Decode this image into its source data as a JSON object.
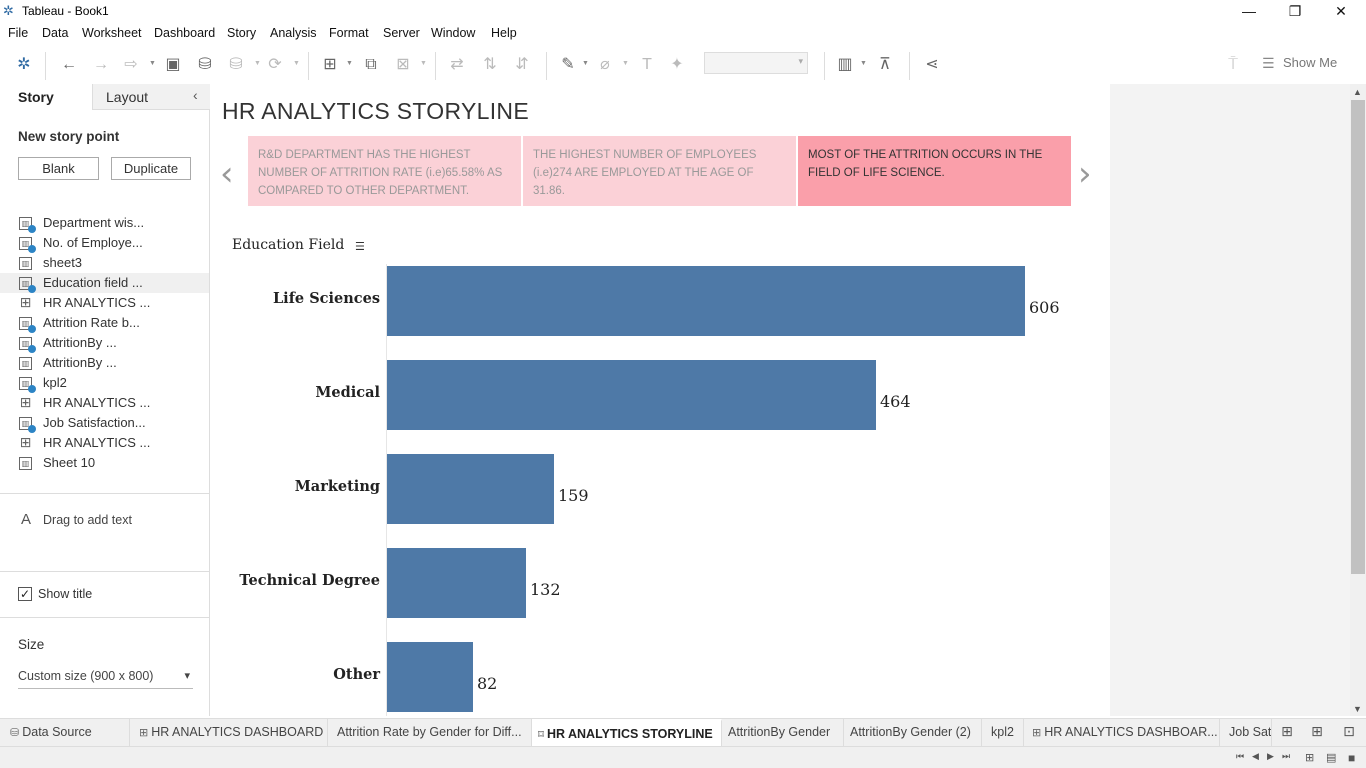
{
  "window": {
    "title": "Tableau - Book1",
    "controls": [
      "minimize",
      "restore",
      "close"
    ]
  },
  "menu": [
    "File",
    "Data",
    "Worksheet",
    "Dashboard",
    "Story",
    "Analysis",
    "Format",
    "Server",
    "Window",
    "Help"
  ],
  "toolbar": {
    "show_me": "Show Me"
  },
  "sidebar": {
    "tabs": {
      "story": "Story",
      "layout": "Layout"
    },
    "new_story_point": "New story point",
    "blank_button": "Blank",
    "duplicate_button": "Duplicate",
    "sheets": [
      {
        "label": "Department wis...",
        "type": "sheet",
        "used": true
      },
      {
        "label": "No. of Employe...",
        "type": "sheet",
        "used": true
      },
      {
        "label": "sheet3",
        "type": "sheet",
        "used": false
      },
      {
        "label": "Education field ...",
        "type": "sheet",
        "used": true
      },
      {
        "label": "HR ANALYTICS ...",
        "type": "dashboard",
        "used": false
      },
      {
        "label": "Attrition Rate b...",
        "type": "sheet",
        "used": true
      },
      {
        "label": "AttritionBy ...",
        "type": "sheet",
        "used": true
      },
      {
        "label": "AttritionBy ...",
        "type": "sheet",
        "used": false
      },
      {
        "label": "kpl2",
        "type": "sheet",
        "used": true
      },
      {
        "label": "HR ANALYTICS ...",
        "type": "dashboard",
        "used": false
      },
      {
        "label": "Job Satisfaction...",
        "type": "sheet",
        "used": true
      },
      {
        "label": "HR ANALYTICS ...",
        "type": "dashboard",
        "used": false
      },
      {
        "label": "Sheet 10",
        "type": "sheet",
        "used": false
      }
    ],
    "drag_to_add_text": "Drag to add text",
    "show_title": "Show title",
    "show_title_checked": true,
    "size_heading": "Size",
    "size_value": "Custom size (900 x 800)"
  },
  "story": {
    "title": "HR ANALYTICS STORYLINE",
    "story_points": [
      {
        "text": "R&D DEPARTMENT HAS THE HIGHEST NUMBER OF  ATTRITION RATE  (i.e)65.58% AS COMPARED TO OTHER DEPARTMENT.",
        "active": false
      },
      {
        "text": "THE HIGHEST NUMBER OF EMPLOYEES (i.e)274 ARE EMPLOYED AT THE AGE OF 31.86.",
        "active": false
      },
      {
        "text": "MOST OF THE ATTRITION OCCURS IN THE FIELD OF LIFE SCIENCE.",
        "active": true
      }
    ],
    "colors": {
      "story_point": "#fbd1d7",
      "story_point_active": "#fa9faa",
      "bar": "#4e79a7"
    }
  },
  "chart_data": {
    "type": "bar",
    "orientation": "horizontal",
    "title": "",
    "row_header": "Education Field",
    "categories": [
      "Life Sciences",
      "Medical",
      "Marketing",
      "Technical Degree",
      "Other"
    ],
    "values": [
      606,
      464,
      159,
      132,
      82
    ],
    "xlim": [
      0,
      660
    ],
    "grid": false,
    "legend": "none",
    "sorted": "descending"
  },
  "tabs": [
    {
      "label": "Data Source",
      "icon": "database-icon",
      "active": false
    },
    {
      "label": "HR ANALYTICS DASHBOARD",
      "icon": "dashboard-icon",
      "active": false
    },
    {
      "label": "Attrition Rate by Gender for Diff...",
      "icon": "",
      "active": false
    },
    {
      "label": "HR ANALYTICS STORYLINE",
      "icon": "story-icon",
      "active": true
    },
    {
      "label": "AttritionBy Gender",
      "icon": "",
      "active": false
    },
    {
      "label": "AttritionBy Gender (2)",
      "icon": "",
      "active": false
    },
    {
      "label": "kpl2",
      "icon": "",
      "active": false
    },
    {
      "label": "HR ANALYTICS DASHBOAR...",
      "icon": "dashboard-icon",
      "active": false
    },
    {
      "label": "Job Sat",
      "icon": "",
      "active": false
    }
  ]
}
